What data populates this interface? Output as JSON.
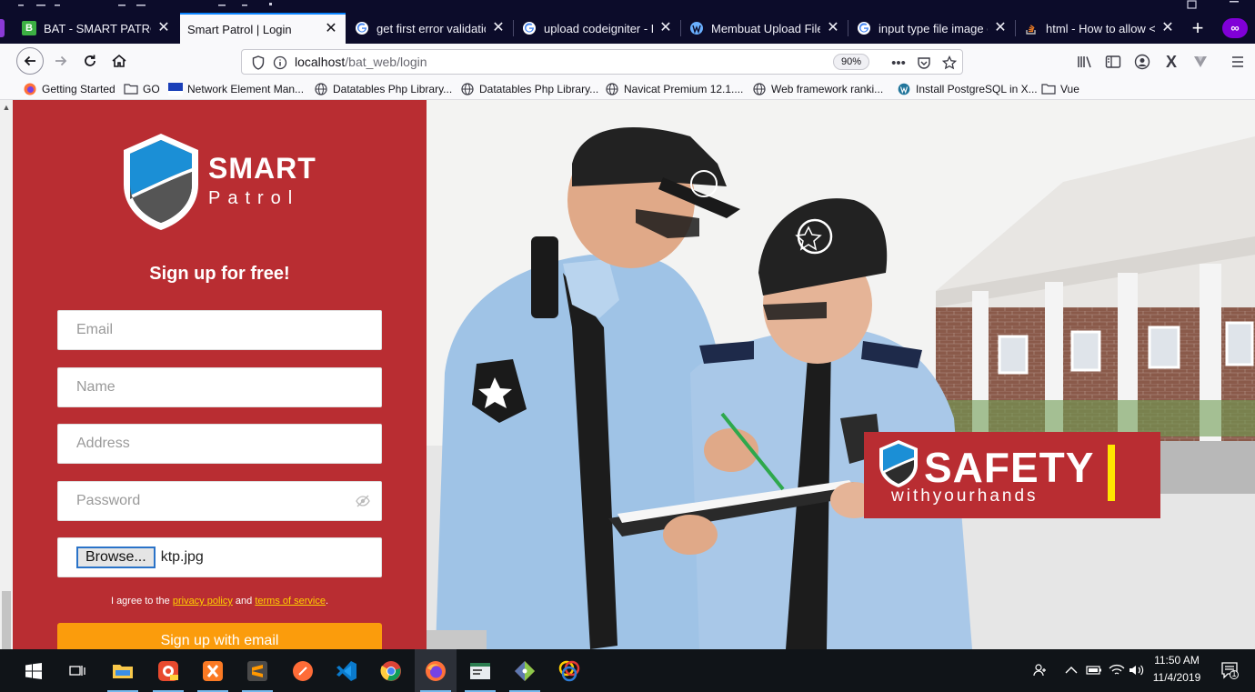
{
  "browser": {
    "tabs": [
      {
        "title": "BAT - SMART PATROL",
        "favicon": "B",
        "active": false
      },
      {
        "title": "Smart Patrol | Login",
        "favicon": "",
        "active": true
      },
      {
        "title": "get first error validation",
        "favicon": "G",
        "active": false
      },
      {
        "title": "upload codeigniter - Pe",
        "favicon": "G",
        "active": false
      },
      {
        "title": "Membuat Upload File D",
        "favicon": "wp",
        "active": false
      },
      {
        "title": "input type file image o",
        "favicon": "G",
        "active": false
      },
      {
        "title": "html - How to allow <i",
        "favicon": "so",
        "active": false
      }
    ],
    "url_host": "localhost",
    "url_path": "/bat_web/login",
    "zoom": "90%",
    "bookmarks": [
      "Getting Started",
      "GO",
      "Network Element Man...",
      "Datatables Php Library...",
      "Datatables Php Library...",
      "Navicat Premium 12.1....",
      "Web framework ranki...",
      "Install PostgreSQL in X...",
      "Vue"
    ]
  },
  "page": {
    "logo": {
      "smart": "SMART",
      "patrol": "Patrol"
    },
    "title": "Sign up for free!",
    "fields": {
      "email_placeholder": "Email",
      "name_placeholder": "Name",
      "address_placeholder": "Address",
      "password_placeholder": "Password"
    },
    "file": {
      "browse_label": "Browse...",
      "file_name": "ktp.jpg"
    },
    "agree": {
      "prefix": "I agree to the ",
      "privacy": "privacy policy",
      "and": " and ",
      "terms": "terms of service",
      "suffix": "."
    },
    "signup_button": "Sign up with email",
    "banner": {
      "word": "SAFETY",
      "tagline": "withyourhands"
    }
  },
  "taskbar": {
    "time": "11:50 AM",
    "date": "11/4/2019",
    "notification_count": "1"
  },
  "colors": {
    "brand_red": "#b92d32",
    "signup_orange": "#fb9c0c",
    "link_yellow": "#ffd000",
    "banner_yellow": "#ffe600",
    "tab_accent": "#0a84ff",
    "private_purple": "#8000d7"
  }
}
